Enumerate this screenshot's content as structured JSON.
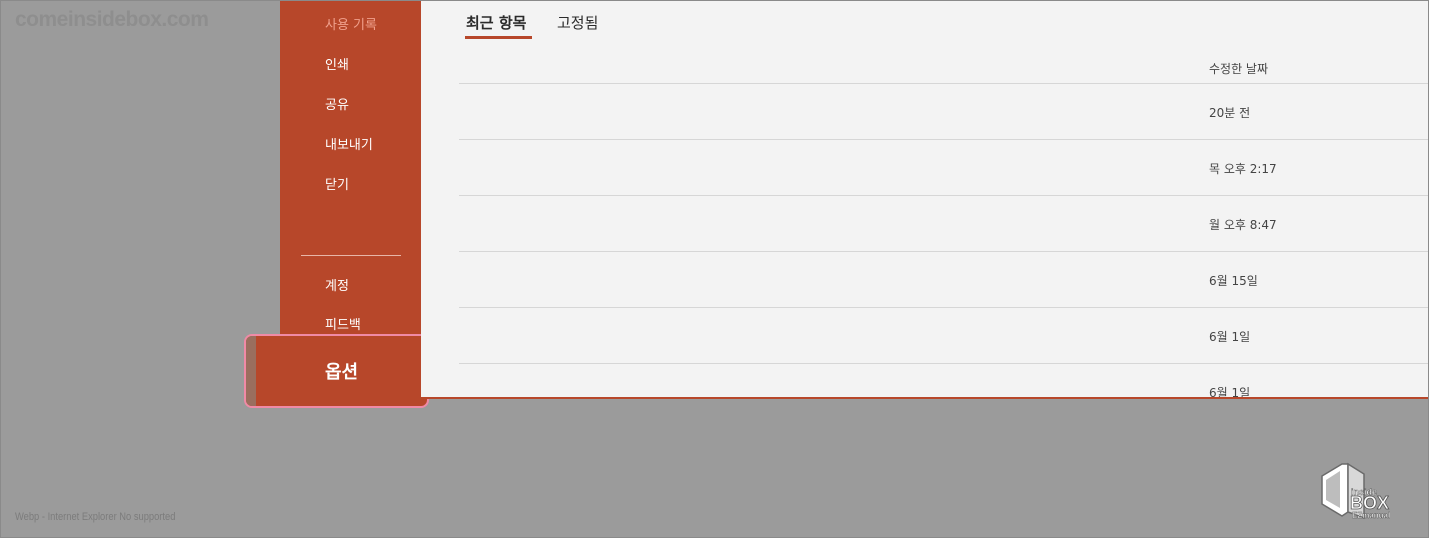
{
  "watermark": "comeinsidebox.com",
  "footer_note": "Webp - Internet Explorer No supported",
  "sidebar": {
    "items": [
      {
        "label": "사용 기록"
      },
      {
        "label": "인쇄"
      },
      {
        "label": "공유"
      },
      {
        "label": "내보내기"
      },
      {
        "label": "닫기"
      },
      {
        "label": "계정"
      },
      {
        "label": "피드백"
      }
    ],
    "options_label": "옵션"
  },
  "main": {
    "tabs": [
      {
        "label": "최근 항목",
        "active": true
      },
      {
        "label": "고정됨",
        "active": false
      }
    ],
    "column_header": "수정한 날짜",
    "rows": [
      {
        "date": "20분 전"
      },
      {
        "date": "목 오후 2:17"
      },
      {
        "date": "월 오후 8:47"
      },
      {
        "date": "6월 15일"
      },
      {
        "date": "6월 1일"
      },
      {
        "date": "6월 1일"
      }
    ]
  },
  "logo": {
    "inside": "inside",
    "box": "BOX",
    "ez": "EZmanual"
  },
  "colors": {
    "accent": "#b7472a",
    "background": "#9b9b9b",
    "panel": "#f3f3f3",
    "highlight": "#f08aa6"
  }
}
